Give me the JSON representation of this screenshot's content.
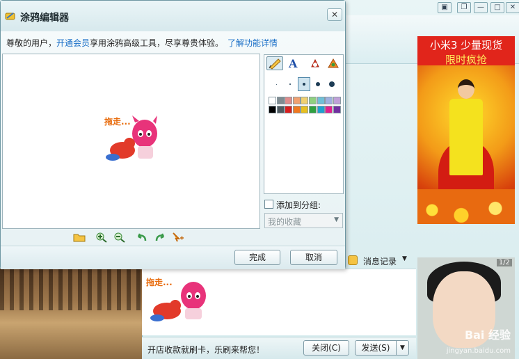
{
  "colors": {
    "accent_link": "#1a6fc7",
    "ad_red": "#e1251b",
    "ad_yellow_text": "#ffea5a",
    "doodle_caption": "#e86a0a",
    "palette": [
      "#ffffff",
      "#7f8b90",
      "#e08c8c",
      "#f0a070",
      "#f0d070",
      "#90d080",
      "#70c0d8",
      "#a0b0e0",
      "#c0a0d8",
      "#000000",
      "#505a60",
      "#d81e1e",
      "#f07820",
      "#e8c020",
      "#30a040",
      "#20a0d0",
      "#e0208c",
      "#7030a0"
    ]
  },
  "background_window": {
    "controls": {
      "skin_icon": "skin-icon",
      "restore": "❐",
      "minimize": "—",
      "maximize": "□",
      "close": "✕"
    },
    "message_history_label": "消息记录",
    "compose_preview_caption": "拖走...",
    "bottom_ad_text": "开店收款就刷卡，乐刷来帮您！",
    "close_button": "关闭(C)",
    "send_button": "发送(S)",
    "send_dropdown": "▼"
  },
  "ads": {
    "top": {
      "line1": "小米3 少量现货",
      "line2": "限时疯抢"
    },
    "bottom": {
      "page_indicator": "1/2",
      "watermark": "Bai 经验",
      "watermark_url": "jingyan.baidu.com"
    }
  },
  "dialog": {
    "title": "涂鸦编辑器",
    "close_glyph": "✕",
    "notice": {
      "part1": "尊敬的用户，",
      "link1": "开通会员",
      "part2": "享用涂鸦高级工具，尽享尊贵体验。",
      "link2": "了解功能详情"
    },
    "canvas_caption": "拖走...",
    "tool_tabs": [
      {
        "name": "pen-tool-icon",
        "active": true
      },
      {
        "name": "text-tool-icon",
        "active": false
      },
      {
        "name": "stamp-tool-icon",
        "active": false
      },
      {
        "name": "effects-tool-icon",
        "active": false
      }
    ],
    "brush_sizes": [
      1,
      2,
      4,
      6,
      8
    ],
    "active_brush_size_index": 2,
    "add_to_group_label": "添加到分组:",
    "group_select_value": "我的收藏",
    "buttons": {
      "done": "完成",
      "cancel": "取消"
    }
  }
}
